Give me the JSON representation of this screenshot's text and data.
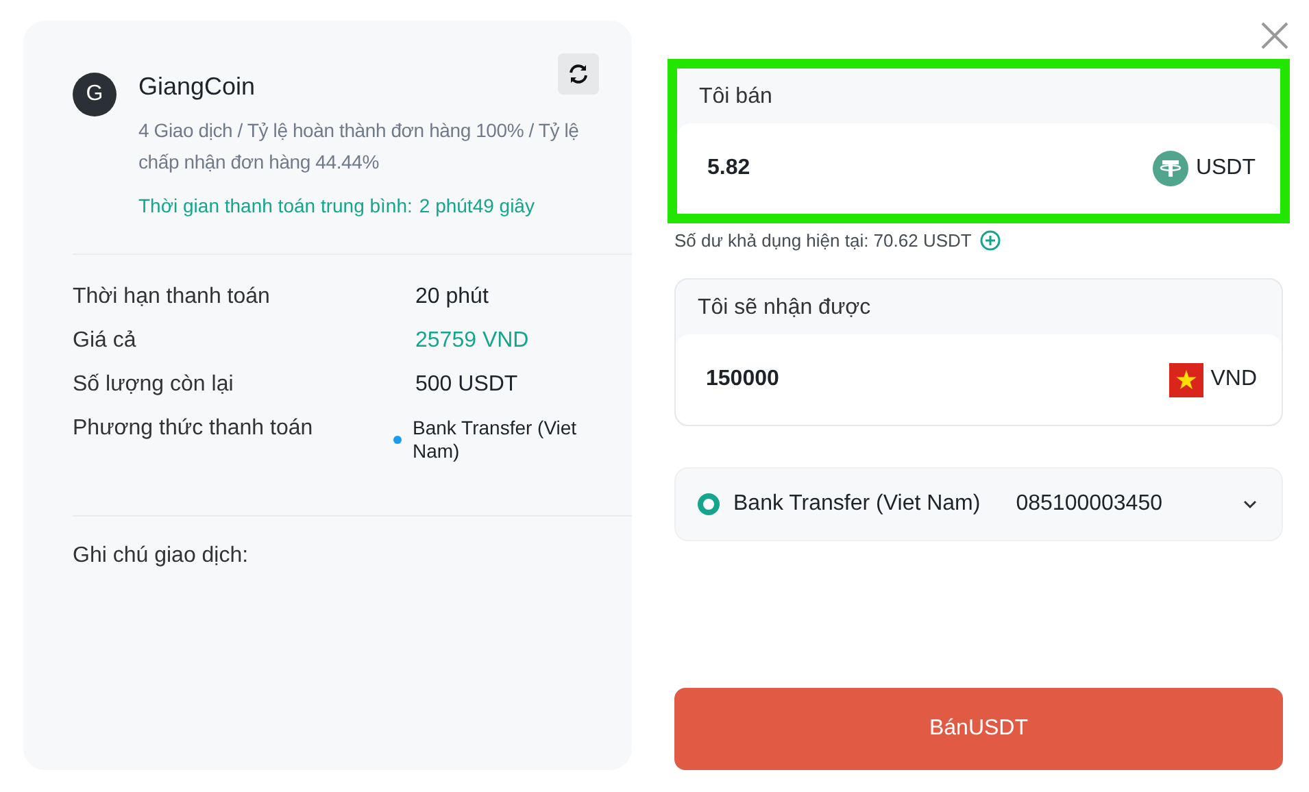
{
  "merchant": {
    "avatar": "G",
    "name": "GiangCoin",
    "stats": "4 Giao dịch / Tỷ lệ hoàn thành đơn hàng 100% / Tỷ lệ chấp nhận đơn hàng 44.44%",
    "avg_time_label": "Thời gian thanh toán trung bình:",
    "avg_time": "2 phút49 giây"
  },
  "details": [
    {
      "label": "Thời hạn thanh toán",
      "value": "20 phút",
      "kind": "plain"
    },
    {
      "label": "Giá cả",
      "value": "25759 VND",
      "kind": "price"
    },
    {
      "label": "Số lượng còn lại",
      "value": "500 USDT",
      "kind": "plain"
    },
    {
      "label": "Phương thức thanh toán",
      "value": "Bank Transfer (Viet Nam)",
      "kind": "method",
      "color": "#1a9cf0"
    }
  ],
  "note_label": "Ghi chú giao dịch:",
  "sell": {
    "label": "Tôi bán",
    "value": "5.82",
    "currency": "USDT",
    "highlighted": true
  },
  "balance": "Số dư khả dụng hiện tại: 70.62 USDT",
  "receive": {
    "label": "Tôi sẽ nhận được",
    "value": "150000",
    "currency": "VND"
  },
  "payment": {
    "method": "Bank Transfer (Viet Nam)",
    "account": "085100003450",
    "selected": true
  },
  "submit": "BánUSDT"
}
